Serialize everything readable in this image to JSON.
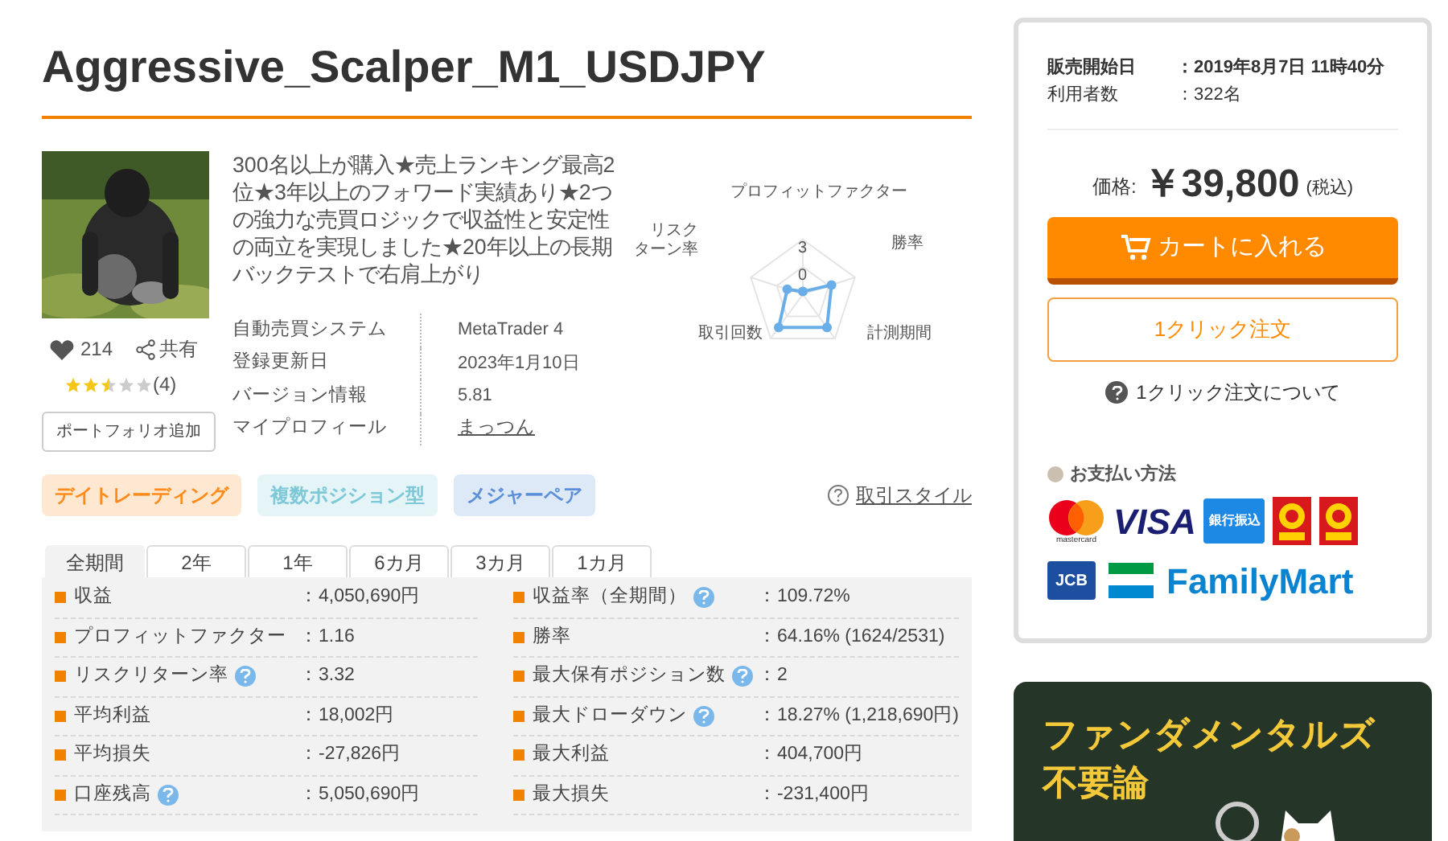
{
  "title": "Aggressive_Scalper_M1_USDJPY",
  "description": "300名以上が購入★売上ランキング最高2位★3年以上のフォワード実績あり★2つの強力な売買ロジックで収益性と安定性の両立を実現しました★20年以上の長期バックテストで右肩上がり",
  "likes": "214",
  "share": "共有",
  "stars": 2.5,
  "review_count": "(4)",
  "portfolio_button": "ポートフォリオ追加",
  "info": [
    {
      "label": "自動売買システム",
      "value": "MetaTrader 4",
      "kind": "text"
    },
    {
      "label": "登録更新日",
      "value": "2023年1月10日",
      "kind": "text"
    },
    {
      "label": "バージョン情報",
      "value": "5.81",
      "kind": "text"
    },
    {
      "label": "マイプロフィール",
      "value": "まっつん",
      "kind": "link"
    }
  ],
  "radar": {
    "axis_labels": [
      {
        "lines": [
          "プロフィットファクター"
        ]
      },
      {
        "lines": [
          "勝率"
        ]
      },
      {
        "lines": [
          "計測期間"
        ]
      },
      {
        "lines": [
          "取引回数"
        ]
      },
      {
        "lines": [
          "リスク",
          "ターン率"
        ]
      }
    ],
    "tick_labels": [
      "3",
      "0"
    ]
  },
  "tags": [
    {
      "label": "デイトレーディング",
      "color": "#ff8c1a"
    },
    {
      "label": "複数ポジション型",
      "color": "#7fc8d8"
    },
    {
      "label": "メジャーペア",
      "color": "#5b8fd8"
    }
  ],
  "style_link": "取引スタイル",
  "tabs": [
    {
      "label": "全期間",
      "selected": true
    },
    {
      "label": "2年",
      "selected": false
    },
    {
      "label": "1年",
      "selected": false
    },
    {
      "label": "6カ月",
      "selected": false
    },
    {
      "label": "3カ月",
      "selected": false
    },
    {
      "label": "1カ月",
      "selected": false
    }
  ],
  "stats_left": [
    {
      "label": "収益",
      "value": "：4,050,690円",
      "help": false
    },
    {
      "label": "プロフィットファクター",
      "value": "：1.16",
      "help": false
    },
    {
      "label": "リスクリターン率",
      "value": "：3.32",
      "help": true
    },
    {
      "label": "平均利益",
      "value": "：18,002円",
      "help": false
    },
    {
      "label": "平均損失",
      "value": "：-27,826円",
      "help": false
    },
    {
      "label": "口座残高",
      "value": "：5,050,690円",
      "help": true
    }
  ],
  "stats_right": [
    {
      "label": "収益率（全期間）",
      "value": "：109.72%",
      "help": true
    },
    {
      "label": "勝率",
      "value": "：64.16% (1624/2531)",
      "help": false
    },
    {
      "label": "最大保有ポジション数",
      "value": "：2",
      "help": true
    },
    {
      "label": "最大ドローダウン",
      "value": "：18.27% (1,218,690円)",
      "help": true
    },
    {
      "label": "最大利益",
      "value": "：404,700円",
      "help": false
    },
    {
      "label": "最大損失",
      "value": "：-231,400円",
      "help": false
    }
  ],
  "sale": [
    {
      "label": "販売開始日",
      "value": "：2019年8月7日 11時40分",
      "bold": true
    },
    {
      "label": "利用者数",
      "value": "：322名",
      "bold": false
    }
  ],
  "price_label": "価格:",
  "price": "￥39,800",
  "tax": "(税込)",
  "cart_button": "カートに入れる",
  "one_click_button": "1クリック注文",
  "one_click_help": "1クリック注文について",
  "payment_title": "お支払い方法",
  "payment": {
    "mastercard": "mastercard",
    "visa": "VISA",
    "bank": "銀行振込",
    "jcb": "JCB",
    "familymart": "FamilyMart"
  },
  "banner": {
    "lines": [
      "ファンダメンタルズ",
      "不要論"
    ]
  }
}
